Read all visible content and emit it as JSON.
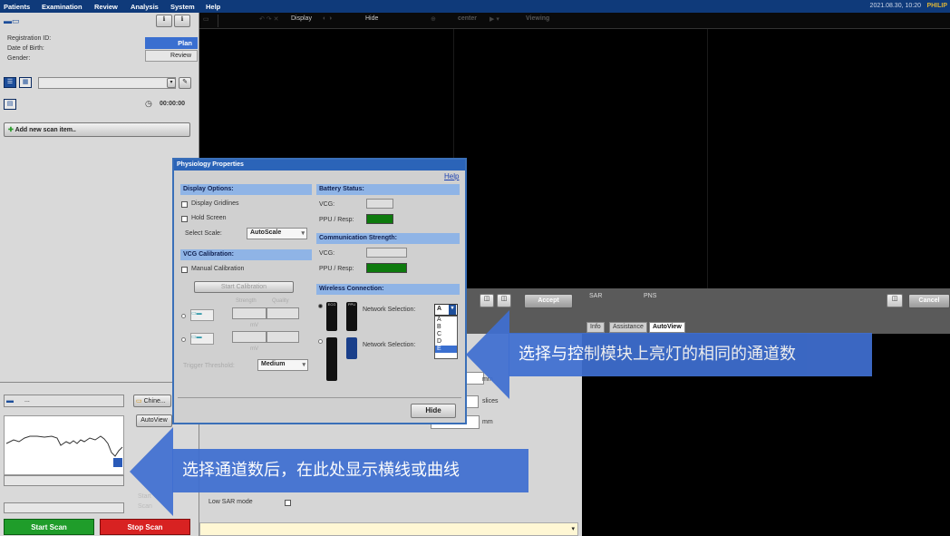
{
  "menu": {
    "items": [
      "Patients",
      "Examination",
      "Review",
      "Analysis",
      "System",
      "Help"
    ],
    "datetime": "2021.08.30, 10:20",
    "brand": "PHILIP"
  },
  "view_toolbar": {
    "display": "Display",
    "hide": "Hide",
    "center": "center",
    "viewing": "Viewing"
  },
  "patient": {
    "reg_label": "Registration ID:",
    "dob_label": "Date of Birth:",
    "gender_label": "Gender:",
    "plan_tab": "Plan",
    "review_tab": "Review",
    "timer": "00:00:00",
    "add_scan": "Add new scan item.."
  },
  "dialog": {
    "title": "Physiology Properties",
    "help": "Help",
    "display_options": "Display Options:",
    "display_gridlines": "Display Gridlines",
    "hold_screen": "Hold Screen",
    "select_scale_label": "Select Scale:",
    "select_scale_value": "AutoScale",
    "vcg_calibration": "VCG Calibration:",
    "manual_calibration": "Manual Calibration",
    "start_calibration": "Start Calibration",
    "strength": "Strength",
    "quality": "Quality",
    "mv1": "mV",
    "mv2": "mV",
    "trigger_threshold": "Trigger Threshold:",
    "threshold_value": "Medium",
    "battery_status": "Battery Status:",
    "vcg": "VCG:",
    "ppu_resp": "PPU / Resp:",
    "comm_strength": "Communication Strength:",
    "vcg2": "VCG:",
    "ppu_resp2": "PPU / Resp:",
    "wireless": "Wireless Connection:",
    "network_sel1": "Network Selection:",
    "network_sel2": "Network Selection:",
    "network_value": "A",
    "network_options": [
      "A",
      "B",
      "C",
      "D",
      "E"
    ],
    "device_label_ecg": "ECG",
    "device_label_ppu": "PPU",
    "hide_button": "Hide"
  },
  "right_panel": {
    "accept": "Accept",
    "sar": "SAR",
    "pns": "PNS",
    "cancel": "Cancel",
    "tabs": [
      "Info",
      "Assistance",
      "AutoView"
    ]
  },
  "lower_left": {
    "mm1": "mm",
    "slices": "slices",
    "mm2": "mm",
    "low_sar": "Low SAR mode"
  },
  "left_bottom": {
    "chinese_btn": "Chine...",
    "autoview": "AutoView",
    "field1": "...",
    "start": "Start Scan",
    "stop": "Stop Scan",
    "faint1": "Start",
    "faint2": "Scan"
  },
  "annotations": {
    "arrow_right": "选择与控制模块上亮灯的相同的通道数",
    "arrow_left": "选择通道数后，在此处显示横线或曲线"
  },
  "colors": {
    "accent_blue": "#3f6fd1",
    "start_green": "#1f9d2a",
    "stop_red": "#d82222",
    "menu_bg": "#0f3a7a"
  }
}
